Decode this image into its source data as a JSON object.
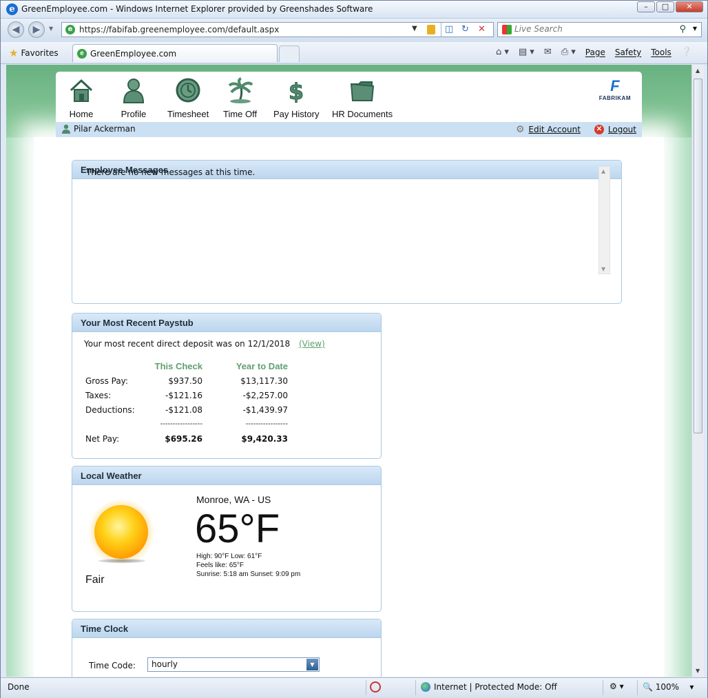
{
  "window": {
    "title": "GreenEmployee.com - Windows Internet Explorer provided by Greenshades Software",
    "min": "–",
    "max": "□",
    "close": "✕"
  },
  "browser": {
    "url": "https://fabifab.greenemployee.com/default.aspx",
    "search_placeholder": "Live Search",
    "favorites_label": "Favorites",
    "tab_title": "GreenEmployee.com",
    "menus": [
      "Page",
      "Safety",
      "Tools"
    ],
    "status_text": "Done",
    "zone_text": "Internet | Protected Mode: Off",
    "zoom": "100%"
  },
  "nav": {
    "items": [
      {
        "label": "Home",
        "icon": "house-icon"
      },
      {
        "label": "Profile",
        "icon": "person-icon"
      },
      {
        "label": "Timesheet",
        "icon": "clock-icon"
      },
      {
        "label": "Time Off",
        "icon": "palm-tree-icon"
      },
      {
        "label": "Pay History",
        "icon": "dollar-icon"
      },
      {
        "label": "HR Documents",
        "icon": "folder-icon"
      }
    ],
    "brand": "FABRIKAM"
  },
  "user": {
    "name": "Pilar Ackerman",
    "edit_account": "Edit Account",
    "logout": "Logout"
  },
  "messages": {
    "title": "Employee Messages",
    "body": "There are no new messages at this time."
  },
  "paystub": {
    "title": "Your Most Recent Paystub",
    "intro": "Your most recent direct deposit was on 12/1/2018",
    "view_link": "(View)",
    "col_this": "This Check",
    "col_ytd": "Year to Date",
    "rows": [
      {
        "label": "Gross Pay:",
        "this": "$937.50",
        "ytd": "$13,117.30"
      },
      {
        "label": "Taxes:",
        "this": "-$121.16",
        "ytd": "-$2,257.00"
      },
      {
        "label": "Deductions:",
        "this": "-$121.08",
        "ytd": "-$1,439.97"
      }
    ],
    "divider_this": "-----------------",
    "divider_ytd": "-----------------",
    "net_label": "Net Pay:",
    "net_this": "$695.26",
    "net_ytd": "$9,420.33"
  },
  "weather": {
    "title": "Local Weather",
    "location": "Monroe, WA - US",
    "temp": "65°F",
    "hilo": "High: 90°F Low: 61°F",
    "feels": "Feels like: 65°F",
    "sun": "Sunrise: 5:18 am Sunset: 9:09 pm",
    "condition": "Fair"
  },
  "timeclock": {
    "title": "Time Clock",
    "code_label": "Time Code:",
    "code_value": "hourly"
  }
}
